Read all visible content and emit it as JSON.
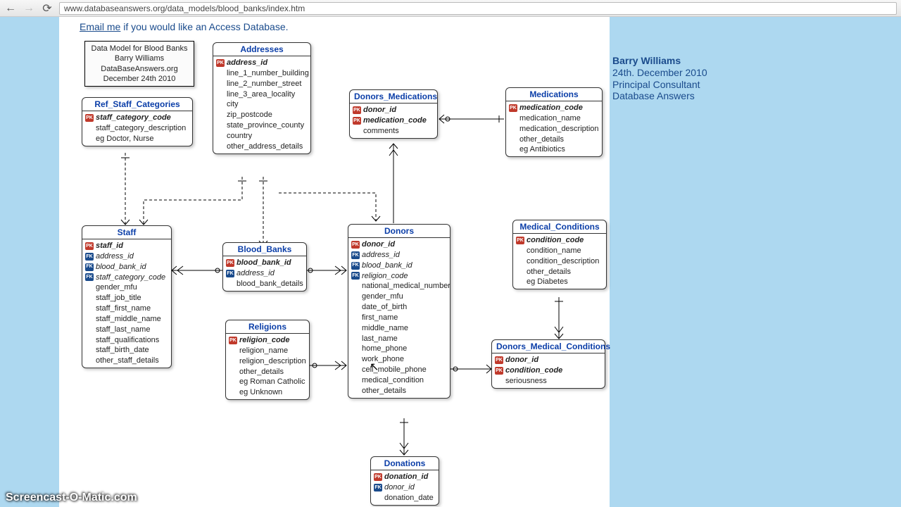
{
  "browser": {
    "url": "www.databaseanswers.org/data_models/blood_banks/index.htm"
  },
  "intro": {
    "link": "Email me",
    "rest": " if you would like an Access Database."
  },
  "sidebar": {
    "name": "Barry Williams",
    "date": "24th. December 2010",
    "role": "Principal Consultant",
    "org": "Database Answers"
  },
  "infocard": {
    "l1": "Data Model for Blood Banks",
    "l2": "Barry Williams",
    "l3": "DataBaseAnswers.org",
    "l4": "December 24th 2010"
  },
  "badges": {
    "pk": "PK",
    "fk": "FK"
  },
  "entities": {
    "ref_staff": {
      "title": "Ref_Staff_Categories",
      "pk0": "staff_category_code",
      "a0": "staff_category_description",
      "a1": "eg Doctor, Nurse"
    },
    "addresses": {
      "title": "Addresses",
      "pk0": "address_id",
      "a0": "line_1_number_building",
      "a1": "line_2_number_street",
      "a2": "line_3_area_locality",
      "a3": "city",
      "a4": "zip_postcode",
      "a5": "state_province_county",
      "a6": "country",
      "a7": "other_address_details"
    },
    "donors_meds": {
      "title": "Donors_Medications",
      "pk0": "donor_id",
      "pk1": "medication_code",
      "a0": "comments"
    },
    "medications": {
      "title": "Medications",
      "pk0": "medication_code",
      "a0": "medication_name",
      "a1": "medication_description",
      "a2": "other_details",
      "a3": "eg Antibiotics"
    },
    "staff": {
      "title": "Staff",
      "pk0": "staff_id",
      "fk0": "address_id",
      "fk1": "blood_bank_id",
      "fk2": "staff_category_code",
      "a0": "gender_mfu",
      "a1": "staff_job_title",
      "a2": "staff_first_name",
      "a3": "staff_middle_name",
      "a4": "staff_last_name",
      "a5": "staff_qualifications",
      "a6": "staff_birth_date",
      "a7": "other_staff_details"
    },
    "blood_banks": {
      "title": "Blood_Banks",
      "pk0": "blood_bank_id",
      "fk0": "address_id",
      "a0": "blood_bank_details"
    },
    "religions": {
      "title": "Religions",
      "pk0": "religion_code",
      "a0": "religion_name",
      "a1": "religion_description",
      "a2": "other_details",
      "a3": "eg Roman Catholic",
      "a4": "eg Unknown"
    },
    "donors": {
      "title": "Donors",
      "pk0": "donor_id",
      "fk0": "address_id",
      "fk1": "blood_bank_id",
      "fk2": "religion_code",
      "a0": "national_medical_number",
      "a1": "gender_mfu",
      "a2": "date_of_birth",
      "a3": "first_name",
      "a4": "middle_name",
      "a5": "last_name",
      "a6": "home_phone",
      "a7": "work_phone",
      "a8": "cell_mobile_phone",
      "a9": "medical_condition",
      "a10": "other_details"
    },
    "med_cond": {
      "title": "Medical_Conditions",
      "pk0": "condition_code",
      "a0": "condition_name",
      "a1": "condition_description",
      "a2": "other_details",
      "a3": "eg Diabetes"
    },
    "donors_mc": {
      "title": "Donors_Medical_Conditions",
      "pk0": "donor_id",
      "pk1": "condition_code",
      "a0": "seriousness"
    },
    "donations": {
      "title": "Donations",
      "pk0": "donation_id",
      "fk0": "donor_id",
      "a0": "donation_date"
    }
  },
  "watermark": "Screencast-O-Matic.com"
}
